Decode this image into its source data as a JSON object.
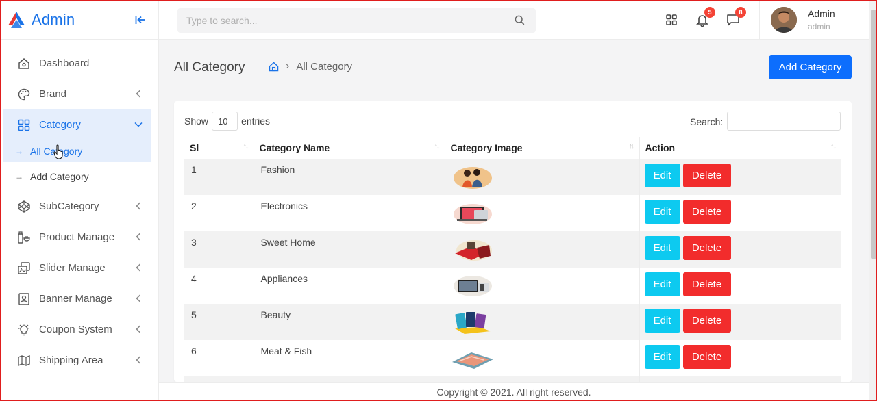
{
  "brand": {
    "name": "Admin"
  },
  "sidebar": {
    "items": [
      {
        "label": "Dashboard",
        "icon": "home-icon"
      },
      {
        "label": "Brand",
        "icon": "palette-icon"
      },
      {
        "label": "Category",
        "icon": "grid-icon",
        "active": true,
        "expanded": true
      },
      {
        "label": "SubCategory",
        "icon": "codepen-icon"
      },
      {
        "label": "Product Manage",
        "icon": "product-icon"
      },
      {
        "label": "Slider Manage",
        "icon": "image-stack-icon"
      },
      {
        "label": "Banner Manage",
        "icon": "banner-icon"
      },
      {
        "label": "Coupon System",
        "icon": "bulb-icon"
      },
      {
        "label": "Shipping Area",
        "icon": "map-icon"
      }
    ],
    "submenu": [
      {
        "label": "All Category",
        "active": true
      },
      {
        "label": "Add Category"
      }
    ]
  },
  "topbar": {
    "search_placeholder": "Type to search...",
    "notifications_count": "5",
    "messages_count": "8",
    "user_name": "Admin",
    "user_role": "admin"
  },
  "page": {
    "title": "All Category",
    "breadcrumb_current": "All Category",
    "add_button": "Add Category"
  },
  "table": {
    "show_label": "Show",
    "entries_value": "10",
    "entries_label": "entries",
    "search_label": "Search:",
    "headers": [
      "Sl",
      "Category Name",
      "Category Image",
      "Action"
    ],
    "edit_label": "Edit",
    "delete_label": "Delete",
    "rows": [
      {
        "sl": "1",
        "name": "Fashion",
        "image": "fashion-image"
      },
      {
        "sl": "2",
        "name": "Electronics",
        "image": "electronics-image"
      },
      {
        "sl": "3",
        "name": "Sweet Home",
        "image": "sweet-home-image"
      },
      {
        "sl": "4",
        "name": "Appliances",
        "image": "appliances-image"
      },
      {
        "sl": "5",
        "name": "Beauty",
        "image": "beauty-image"
      },
      {
        "sl": "6",
        "name": "Meat & Fish",
        "image": "meat-fish-image"
      }
    ]
  },
  "footer": {
    "text": "Copyright © 2021. All right reserved."
  },
  "colors": {
    "primary": "#0d6efd",
    "brand_blue": "#1a73e8",
    "edit": "#0dcaf0",
    "delete": "#f22c2c",
    "badge": "#f44336"
  }
}
